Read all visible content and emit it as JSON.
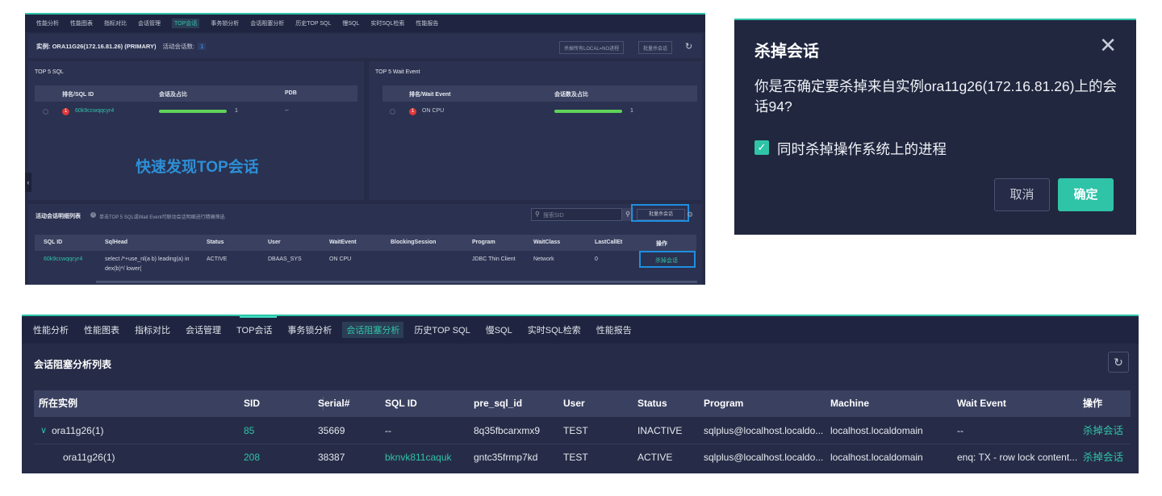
{
  "top_panel": {
    "nav": [
      "性能分析",
      "性能图表",
      "指标对比",
      "会话管理",
      "TOP会话",
      "事务锁分析",
      "会话阻塞分析",
      "历史TOP SQL",
      "慢SQL",
      "实时SQL检索",
      "性能报告"
    ],
    "nav_active": "TOP会话",
    "instance_label": "实例: ORA11G26(172.16.81.26) (PRIMARY)",
    "active_sessions_label": "活动会话数:",
    "active_sessions_count": "1",
    "btn_kill_local": "杀掉所有LOCAL=NO进程",
    "btn_batch_kill": "批量杀会话",
    "top_sql": {
      "title": "TOP 5 SQL",
      "headers": [
        "排名/SQL ID",
        "会话及占比",
        "PDB"
      ],
      "row": {
        "rank": "1",
        "sql_id": "60k9ccwqqcyr4",
        "count": "1",
        "pdb": "--"
      }
    },
    "top_wait": {
      "title": "TOP 5 Wait Event",
      "headers": [
        "排名/Wait Event",
        "会话数及占比"
      ],
      "row": {
        "rank": "1",
        "event": "ON CPU",
        "count": "1"
      }
    },
    "caption": "快速发现TOP会话",
    "list_title": "活动会话明细列表",
    "list_hint": "单击TOP 5 SQL或Wait Event可联动会话明细进行精确筛选",
    "search_placeholder": "搜索SID",
    "list_batch_kill": "批量杀会话",
    "table_headers": [
      "SQL ID",
      "SqlHead",
      "Status",
      "User",
      "WaitEvent",
      "BlockingSession",
      "Program",
      "WaitClass",
      "LastCallEt",
      "操作"
    ],
    "row": {
      "sql_id": "60k9ccwqqcyr4",
      "sqlhead_1": "select /*+use_nl(a b) leading(a) in",
      "sqlhead_2": "dex(b)*/ lower(",
      "status": "ACTIVE",
      "user": "DBAAS_SYS",
      "wait_event": "ON CPU",
      "blocking": "",
      "program": "JDBC Thin Client",
      "wait_class": "Network",
      "last_call": "0",
      "action": "杀掉会话"
    }
  },
  "dialog": {
    "title": "杀掉会话",
    "message": "你是否确定要杀掉来自实例ora11g26(172.16.81.26)上的会话94?",
    "checkbox_label": "同时杀掉操作系统上的进程",
    "checked": true,
    "cancel": "取消",
    "ok": "确定"
  },
  "bottom_panel": {
    "nav": [
      "性能分析",
      "性能图表",
      "指标对比",
      "会话管理",
      "TOP会话",
      "事务锁分析",
      "会话阻塞分析",
      "历史TOP SQL",
      "慢SQL",
      "实时SQL检索",
      "性能报告"
    ],
    "nav_active": "会话阻塞分析",
    "title": "会话阻塞分析列表",
    "headers": [
      "所在实例",
      "SID",
      "Serial#",
      "SQL ID",
      "pre_sql_id",
      "User",
      "Status",
      "Program",
      "Machine",
      "Wait Event",
      "操作"
    ],
    "rows": [
      {
        "instance": "ora11g26(1)",
        "sid": "85",
        "serial": "35669",
        "sql_id": "--",
        "pre_sql_id": "8q35fbcarxmx9",
        "user": "TEST",
        "status": "INACTIVE",
        "program": "sqlplus@localhost.localdo...",
        "machine": "localhost.localdomain",
        "wait_event": "--",
        "action": "杀掉会话"
      },
      {
        "instance": "ora11g26(1)",
        "sid": "208",
        "serial": "38387",
        "sql_id": "bknvk811caquk",
        "pre_sql_id": "gntc35frmp7kd",
        "user": "TEST",
        "status": "ACTIVE",
        "program": "sqlplus@localhost.localdo...",
        "machine": "localhost.localdomain",
        "wait_event": "enq: TX - row lock content...",
        "action": "杀掉会话"
      }
    ]
  },
  "colors": {
    "accent": "#2fc3a8",
    "bg": "#262c47",
    "highlight": "#1e8fe0",
    "danger": "#e03a3a",
    "bar": "#5fd35a"
  }
}
